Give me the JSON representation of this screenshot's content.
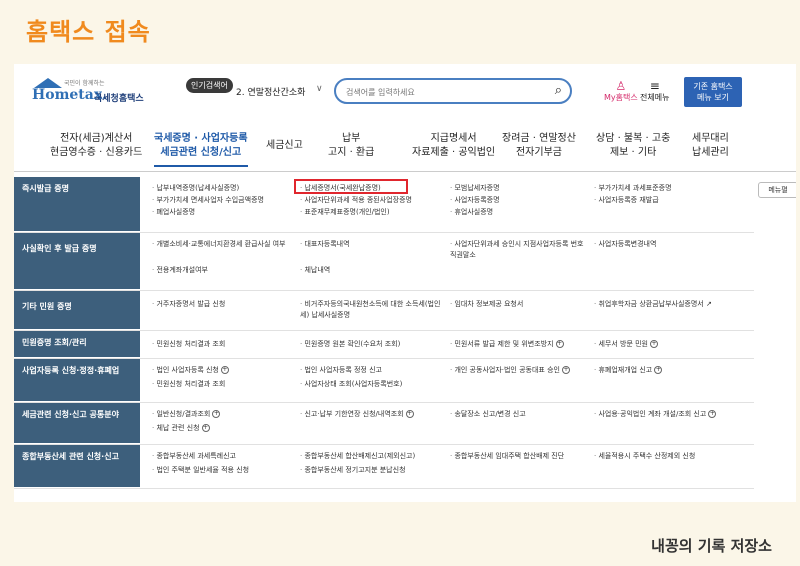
{
  "slide": {
    "title": "홈택스 접속",
    "footer": "내꽁의 기록 저장소"
  },
  "header": {
    "logo_tag": "국민이 함께하는",
    "logo_brand": "Hometax.",
    "logo_kr": "국세청홈택스",
    "popular_label": "인기검색어",
    "popular_term": "2. 연말정산간소화",
    "search_placeholder": "검색어를 입력하세요",
    "myhome_label": "My홈택스",
    "allmenu_label": "전체메뉴",
    "classic_line1": "기존 홈택스",
    "classic_line2": "메뉴 보기"
  },
  "nav": [
    {
      "l1": "전자(세금)계산서",
      "l2": "현금영수증 · 신용카드"
    },
    {
      "l1": "국세증명 · 사업자등록",
      "l2": "세금관련 신청/신고"
    },
    {
      "l1": "세금신고",
      "l2": ""
    },
    {
      "l1": "납부",
      "l2": "고지 · 환급"
    },
    {
      "l1": "지급명세서",
      "l2": "자료제출 · 공익법인"
    },
    {
      "l1": "장려금 · 연말정산",
      "l2": "전자기부금"
    },
    {
      "l1": "상담 · 불복 · 고충",
      "l2": "제보 · 기타"
    },
    {
      "l1": "세무대리",
      "l2": "납세관리"
    }
  ],
  "side_button": "메뉴펼",
  "rows": [
    {
      "head": "즉시발급 증명",
      "cells": [
        "납부내역증명(납세사실증명)",
        "부가가치세 면세사업자 수입금액증명",
        "폐업사실증명",
        "납세증명서(국세완납증명)",
        "사업자단위과세 적용 종된사업장증명",
        "표준재무제표증명(개인/법인)",
        "모범납세자증명",
        "사업자등록증명",
        "휴업사실증명",
        "부가가치세 과세표준증명",
        "사업자등록증 재발급"
      ]
    },
    {
      "head": "사실확인 후 발급 증명",
      "cells": [
        "개별소비세·교통에너지환경세 환급사실 여부",
        "전용계좌개설여부",
        "대표자등록내역",
        "체납내역",
        "사업자단위과세 승인시 지점사업자등록 번호 직권말소",
        "사업자등록변경내역"
      ]
    },
    {
      "head": "기타 민원 증명",
      "cells": [
        "거주자증명서 발급 신청",
        "비거주자등의국내원천소득에 대한 소득세(법인세) 납세사실증명",
        "임대차 정보제공 요청서",
        "취업후학자금 상환금납부사실증명서"
      ]
    },
    {
      "head": "민원증명 조회/관리",
      "cells": [
        "민원신청 처리결과 조회",
        "민원증명 원본 확인(수요처 조회)",
        "민원서류 발급 제한 및 위변조방지",
        "세무서 방문 민원"
      ]
    },
    {
      "head": "사업자등록 신청·정정·휴폐업",
      "cells": [
        "법인 사업자등록 신청",
        "민원신청 처리결과 조회",
        "법인 사업자등록 정정 신고",
        "사업자상태 조회(사업자등록번호)",
        "개인 공동사업자·법인 공동대표 승인",
        "휴폐업재개업 신고"
      ]
    },
    {
      "head": "세금관련 신청·신고 공통분야",
      "cells": [
        "일반신청/결과조회",
        "체납 관련 신청",
        "신고·납부 기한연장 신청/내역조회",
        "송달장소 신고/변경 신고",
        "사업용·공익법인 계좌 개설/조회 신고"
      ]
    },
    {
      "head": "종합부동산세 관련 신청·신고",
      "cells": [
        "종합부동산세 과세특례신고",
        "법인 주택분 일반세율 적용 신청",
        "종합부동산세 합산배제신고(제외신고)",
        "종합부동산세 정기고지분 분납신청",
        "종합부동산세 임대주택 합산배제 진단",
        "세율적용시 주택수 산정제외 신청"
      ]
    }
  ]
}
